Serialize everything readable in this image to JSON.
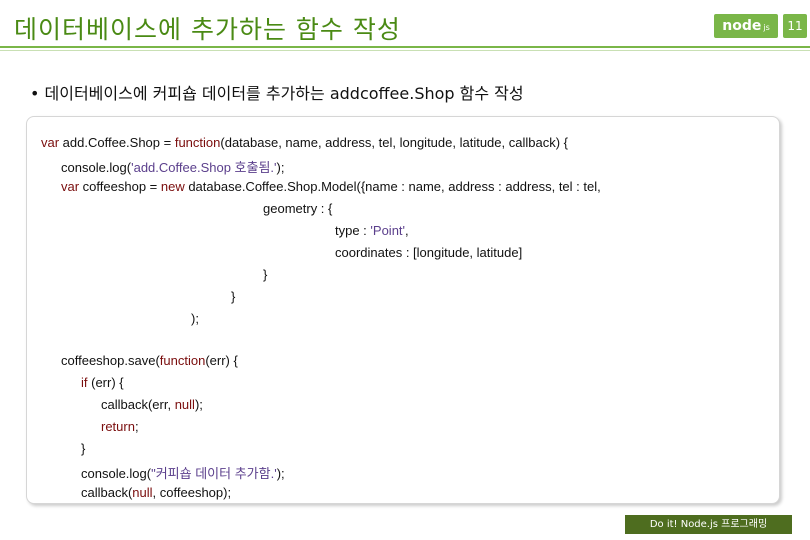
{
  "header": {
    "title": "데이터베이스에 추가하는 함수 작성",
    "logo_text": "node",
    "logo_suffix": "js",
    "page_number": "11"
  },
  "bullet": "• 데이터베이스에 커피숍 데이터를 추가하는 addcoffee.Shop 함수 작성",
  "code": {
    "l1_kw": "var",
    "l1_a": " add.Coffee.Shop = ",
    "l1_kw2": "function",
    "l1_b": "(database, name, address, tel, longitude, latitude, callback) {",
    "l2_a": "console.log(",
    "l2_str": "'add.Coffee.Shop 호출됨.'",
    "l2_b": ");",
    "l3_kw": "var",
    "l3_a": " coffeeshop = ",
    "l3_kw2": "new",
    "l3_b": " database.Coffee.Shop.Model({name : name, address : address, tel : tel,",
    "l4": "geometry : {",
    "l5_a": "type : ",
    "l5_str": "'Point'",
    "l5_b": ",",
    "l6": "coordinates : [longitude, latitude]",
    "l7": "}",
    "l8": "}",
    "l9": ");",
    "l10_a": "coffeeshop.save(",
    "l10_kw": "function",
    "l10_b": "(err) {",
    "l11_kw": "if",
    "l11_b": " (err) {",
    "l12_a": "callback(err, ",
    "l12_kw": "null",
    "l12_b": ");",
    "l13_kw": "return",
    "l13_b": ";",
    "l14": "}",
    "l15_a": "console.log(",
    "l15_str": "\"커피숍 데이터 추가함.'",
    "l15_b": ");",
    "l16_a": "callback(",
    "l16_kw": "null",
    "l16_b": ", coffeeshop);"
  },
  "footer": "Do it! Node.js 프로그래밍"
}
